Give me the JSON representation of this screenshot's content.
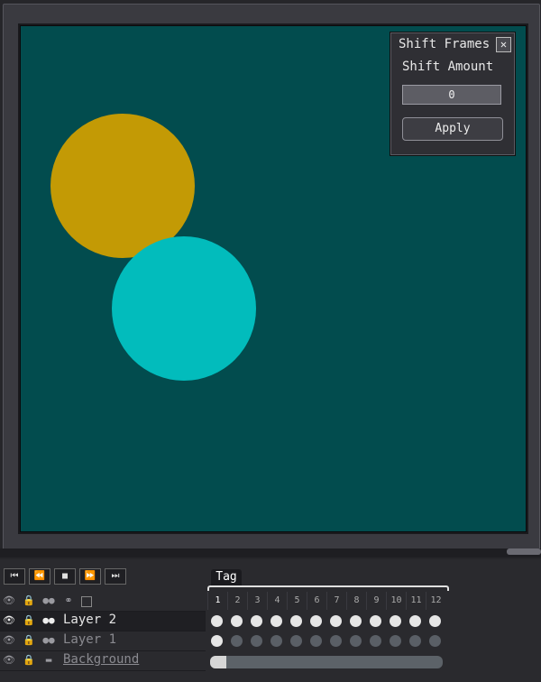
{
  "canvas": {
    "background": "#024c4e",
    "circles": [
      {
        "color": "#c39a05"
      },
      {
        "color": "#02bcbc"
      }
    ]
  },
  "dialog": {
    "title": "Shift Frames",
    "close_glyph": "✕",
    "field_label": "Shift Amount",
    "field_value": "0",
    "apply_label": "Apply"
  },
  "playback": {
    "buttons": [
      {
        "name": "first-frame",
        "glyph": "⏮"
      },
      {
        "name": "prev-frame",
        "glyph": "⏪"
      },
      {
        "name": "stop",
        "glyph": "■"
      },
      {
        "name": "next-frame",
        "glyph": "⏩"
      },
      {
        "name": "last-frame",
        "glyph": "⏭"
      }
    ]
  },
  "tag": {
    "label": "Tag"
  },
  "frames": [
    "1",
    "2",
    "3",
    "4",
    "5",
    "6",
    "7",
    "8",
    "9",
    "10",
    "11",
    "12"
  ],
  "current_frame": "1",
  "layers": [
    {
      "name": "Layer 2",
      "active": true,
      "cels": [
        1,
        1,
        1,
        1,
        1,
        1,
        1,
        1,
        1,
        1,
        1,
        1
      ]
    },
    {
      "name": "Layer 1",
      "active": false,
      "cels": [
        1,
        0,
        0,
        0,
        0,
        0,
        0,
        0,
        0,
        0,
        0,
        0
      ]
    },
    {
      "name": "Background",
      "active": false,
      "linked": true
    }
  ],
  "icons": {
    "eye": "eye-icon",
    "lock": "lock-icon",
    "onion": "onion-skin-icon",
    "link": "link-icon"
  }
}
